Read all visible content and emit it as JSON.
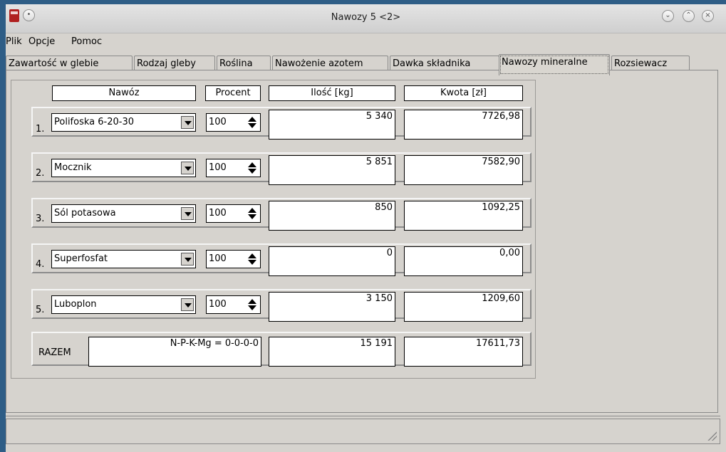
{
  "window": {
    "title": "Nawozy 5 <2>"
  },
  "menu": {
    "items": [
      {
        "label": "Plik"
      },
      {
        "label": "Opcje"
      },
      {
        "label": "Pomoc"
      }
    ]
  },
  "tabs": [
    {
      "label": "Zawartość w glebie"
    },
    {
      "label": "Rodzaj gleby"
    },
    {
      "label": "Roślina"
    },
    {
      "label": "Nawożenie azotem"
    },
    {
      "label": "Dawka składnika"
    },
    {
      "label": "Nawozy mineralne",
      "active": true
    },
    {
      "label": "Rozsiewacz"
    }
  ],
  "table": {
    "headers": {
      "fertilizer": "Nawóz",
      "percent": "Procent",
      "amount": "Ilość [kg]",
      "cost": "Kwota [zł]"
    },
    "rows": [
      {
        "num": "1.",
        "fertilizer": "Polifoska 6-20-30",
        "percent": "100",
        "amount": "5 340",
        "cost": "7726,98"
      },
      {
        "num": "2.",
        "fertilizer": "Mocznik",
        "percent": "100",
        "amount": "5 851",
        "cost": "7582,90"
      },
      {
        "num": "3.",
        "fertilizer": "Sól potasowa",
        "percent": "100",
        "amount": "850",
        "cost": "1092,25"
      },
      {
        "num": "4.",
        "fertilizer": "Superfosfat",
        "percent": "100",
        "amount": "0",
        "cost": "0,00"
      },
      {
        "num": "5.",
        "fertilizer": "Luboplon",
        "percent": "100",
        "amount": "3 150",
        "cost": "1209,60"
      }
    ],
    "total": {
      "label": "RAZEM",
      "npk": "N-P-K-Mg = 0-0-0-0",
      "amount": "15 191",
      "cost": "17611,73"
    }
  },
  "statusbar": {
    "text": ""
  },
  "colors": {
    "window_bg": "#d6d3ce",
    "desktop_bg": "#2e5d86",
    "field_bg": "#ffffff"
  }
}
